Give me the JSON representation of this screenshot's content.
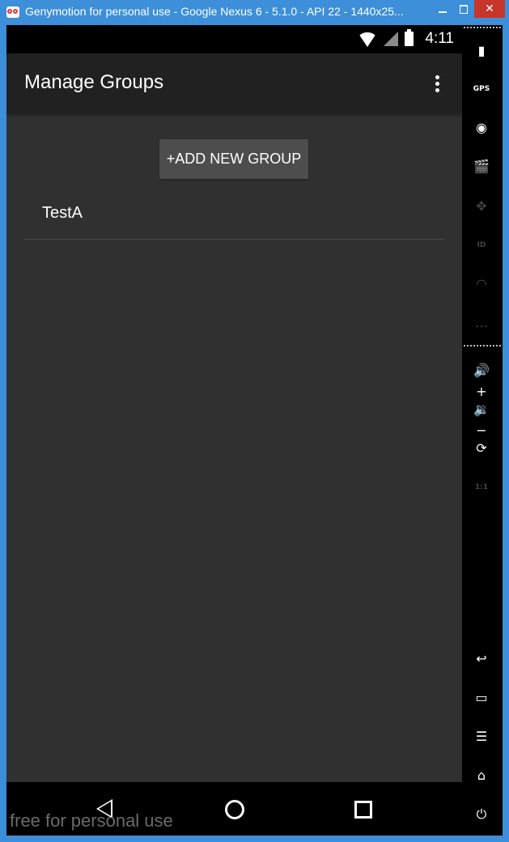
{
  "window": {
    "title": "Genymotion for personal use - Google Nexus 6 - 5.1.0 - API 22 - 1440x25...",
    "close_glyph": "✕"
  },
  "status_bar": {
    "time": "4:11"
  },
  "app_bar": {
    "title": "Manage Groups"
  },
  "main": {
    "add_button_label": "+ADD NEW GROUP",
    "groups": [
      {
        "label": "TestA"
      }
    ]
  },
  "watermark": "free for personal use",
  "sidebar": {
    "battery_icon": "▮",
    "gps_label": "GPS",
    "camera_icon": "◉",
    "clapper_icon": "🎬",
    "dpad_icon": "✥",
    "id_label": "ID",
    "rss_icon": "◠",
    "sms_icon": "…",
    "volume_up_icon": "🔊+",
    "volume_down_icon": "🔉−",
    "rotate_icon": "⟳",
    "scale_label": "1:1",
    "back_icon": "↩",
    "recent_icon": "▭",
    "menu_icon": "☰",
    "home_icon": "⌂",
    "power_icon": "⏻"
  },
  "colors": {
    "screen_bg": "#303030",
    "appbar_bg": "#212121",
    "button_bg": "#4d4d4d",
    "window_frame": "#3c8fd8",
    "close_button": "#c7352b"
  }
}
